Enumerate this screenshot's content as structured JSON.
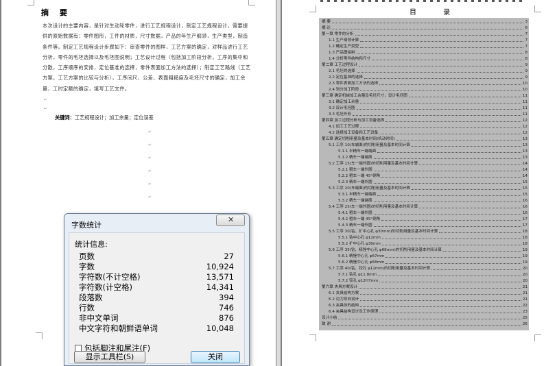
{
  "left_page": {
    "abstract_title": "摘  要",
    "abstract_text": "本次设计的主要内容，是针对生动轮零件，进行工艺规程设计，制定工艺规程设计，需要提供的原始数据有：零件图形，工件的材质，尺寸数据，产品的年生产纲领，生产类型，制造条件等。制定工艺规程设计步骤如下：审查零件的图样，工艺方案的确定，对样品进行工艺分析，零件的毛坯选择以及毛坯图说明；工艺设计过程（包括加工阶段分析，工序的集中和分散，工序顺序的安排，定位基准的选择，零件表面加工方法的选择）；制定工艺路线（工艺方案，工艺方案的比较与分析），工序间尺、公差、表面粗糙度及毛坯尺寸的确定，加工余量、工时定额的确定，填写工艺文件。",
    "keywords_label": "关键词：",
    "keywords": "工艺规程设计；加工余量；定位误差"
  },
  "right_page": {
    "toc_title": "目 录",
    "toc": [
      {
        "t": "摘      要",
        "p": "3",
        "i": 0
      },
      {
        "t": "摘      论",
        "p": "6",
        "i": 0
      },
      {
        "t": "第一章  零件的分析",
        "p": "7",
        "i": 0
      },
      {
        "t": "1.1 生产纲领计算",
        "p": "7",
        "i": 1
      },
      {
        "t": "1.2 确定生产类型",
        "p": "7",
        "i": 1
      },
      {
        "t": "1.3 产品图绘制",
        "p": "8",
        "i": 1
      },
      {
        "t": "1.4 分析零件结构和尺寸",
        "p": "8",
        "i": 1
      },
      {
        "t": "第二章  工艺过程设计",
        "p": "9",
        "i": 0
      },
      {
        "t": "2.1 毛坯的选择",
        "p": "9",
        "i": 1
      },
      {
        "t": "2.2 定位基准的选择",
        "p": "9",
        "i": 1
      },
      {
        "t": "2.3 零件表面加工方法的选择",
        "p": "10",
        "i": 1
      },
      {
        "t": "2.4 划分加工阶段",
        "p": "10",
        "i": 1
      },
      {
        "t": "第三章  确定机械加工余量及毛坯尺寸，设计毛坯图",
        "p": "11",
        "i": 0
      },
      {
        "t": "3.1 确定加工余量",
        "p": "11",
        "i": 1
      },
      {
        "t": "3.2 设计毛坯图",
        "p": "11",
        "i": 1
      },
      {
        "t": "3.3 毛坯外形",
        "p": "11",
        "i": 1
      },
      {
        "t": "第四章  加工过程分析与加工设备选择",
        "p": "12",
        "i": 0
      },
      {
        "t": "4.1 加工工艺过程",
        "p": "12",
        "i": 1
      },
      {
        "t": "4.2 选择加工设备和工艺设备",
        "p": "12",
        "i": 1
      },
      {
        "t": "第五章  确定切削用量及基本时间(机动时间)",
        "p": "13",
        "i": 0
      },
      {
        "t": "5.1 工序 10(车端面)的切削用量及基本时间计算",
        "p": "13",
        "i": 1
      },
      {
        "t": "5.1.1 半精车一端端面",
        "p": "13",
        "i": 2
      },
      {
        "t": "5.1.2 精车一端端面",
        "p": "13",
        "i": 2
      },
      {
        "t": "5.2 工序 15(车一端外圆)的切削用量及基本时间计算",
        "p": "14",
        "i": 1
      },
      {
        "t": "5.2.1 粗车一端外圆",
        "p": "14",
        "i": 2
      },
      {
        "t": "5.2.2 粗车一端 45°倒角",
        "p": "14",
        "i": 2
      },
      {
        "t": "5.2.3 精车一端外圆",
        "p": "15",
        "i": 2
      },
      {
        "t": "5.3 工序 20(车端面)的切削用量及基本时间计算",
        "p": "15",
        "i": 1
      },
      {
        "t": "5.3.1 半精车一端端面",
        "p": "15",
        "i": 2
      },
      {
        "t": "5.3.2 精车一端端面",
        "p": "16",
        "i": 2
      },
      {
        "t": "5.4 工序 25(车一端外圆)的切削用量及基本时间计算",
        "p": "16",
        "i": 1
      },
      {
        "t": "5.4.1 粗车一端外圆",
        "p": "16",
        "i": 2
      },
      {
        "t": "5.4.2 粗车一端 45°倒角",
        "p": "17",
        "i": 2
      },
      {
        "t": "5.4.3 精车一端外圆",
        "p": "17",
        "i": 2
      },
      {
        "t": "5.5 工序 30(钻、扩中心孔 φ30mm)的切削用量及基本时间计算",
        "p": "18",
        "i": 1
      },
      {
        "t": "5.5.1 钻中心孔 φ12mm",
        "p": "18",
        "i": 2
      },
      {
        "t": "5.5.2 扩中心孔 φ30mm",
        "p": "18",
        "i": 2
      },
      {
        "t": "5.6 工序 35(钻、精锉中心孔 φ68mm)的切削用量及基本时间计算",
        "p": "19",
        "i": 1
      },
      {
        "t": "5.6.1 精锉中心孔 φ67mm",
        "p": "19",
        "i": 2
      },
      {
        "t": "5.6.2 精锉中心孔 φ68mm",
        "p": "19",
        "i": 2
      },
      {
        "t": "5.7 工序 40(钻、铰孔 φ12mm)的切削用量及基本时间计算",
        "p": "20",
        "i": 1
      },
      {
        "t": "5.7.1 钻孔 φ11.8mm",
        "p": "20",
        "i": 2
      },
      {
        "t": "5.7.2 铰孔 φ12H7mm",
        "p": "20",
        "i": 2
      },
      {
        "t": "第六章  夹具方案设计",
        "p": "21",
        "i": 0
      },
      {
        "t": "6.1 夹具结构方案",
        "p": "21",
        "i": 1
      },
      {
        "t": "6.2 对刀导向设计",
        "p": "21",
        "i": 1
      },
      {
        "t": "6.3 夹具体的结构",
        "p": "22",
        "i": 1
      },
      {
        "t": "6.4 夹具结构设计及工作原理",
        "p": "23",
        "i": 1
      },
      {
        "t": "设计小结",
        "p": "25",
        "i": 0
      },
      {
        "t": "致      谢",
        "p": "26",
        "i": 0
      }
    ]
  },
  "dialog": {
    "title": "字数统计",
    "caption": "统计信息:",
    "stats": [
      {
        "label": "页数",
        "value": "27"
      },
      {
        "label": "字数",
        "value": "10,924"
      },
      {
        "label": "字符数(不计空格)",
        "value": "13,571"
      },
      {
        "label": "字符数(计空格)",
        "value": "14,341"
      },
      {
        "label": "段落数",
        "value": "394"
      },
      {
        "label": "行数",
        "value": "746"
      },
      {
        "label": "非中文单词",
        "value": "876"
      },
      {
        "label": "中文字符和朝鲜语单词",
        "value": "10,048"
      }
    ],
    "checkbox_label": "包括脚注和尾注(F)",
    "toolbar_button": "显示工具栏(S)",
    "close_button": "关闭"
  }
}
